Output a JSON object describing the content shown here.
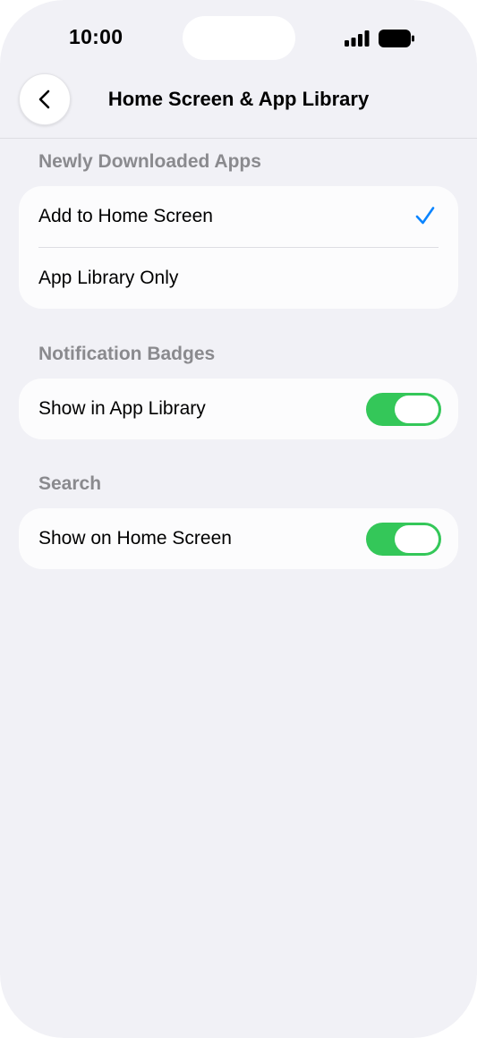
{
  "status": {
    "time": "10:00"
  },
  "nav": {
    "title": "Home Screen & App Library"
  },
  "sections": {
    "downloads": {
      "header": "Newly Downloaded Apps",
      "options": [
        "Add to Home Screen",
        "App Library Only"
      ],
      "selected": "Add to Home Screen"
    },
    "badges": {
      "header": "Notification Badges",
      "label": "Show in App Library",
      "on": true
    },
    "search": {
      "header": "Search",
      "label": "Show on Home Screen",
      "on": true
    }
  },
  "colors": {
    "accent": "#0a84ff",
    "toggle_on": "#34c759",
    "background": "#f1f1f6"
  },
  "icons": [
    "signal-icon",
    "battery-icon",
    "chevron-left-icon",
    "checkmark-icon"
  ]
}
